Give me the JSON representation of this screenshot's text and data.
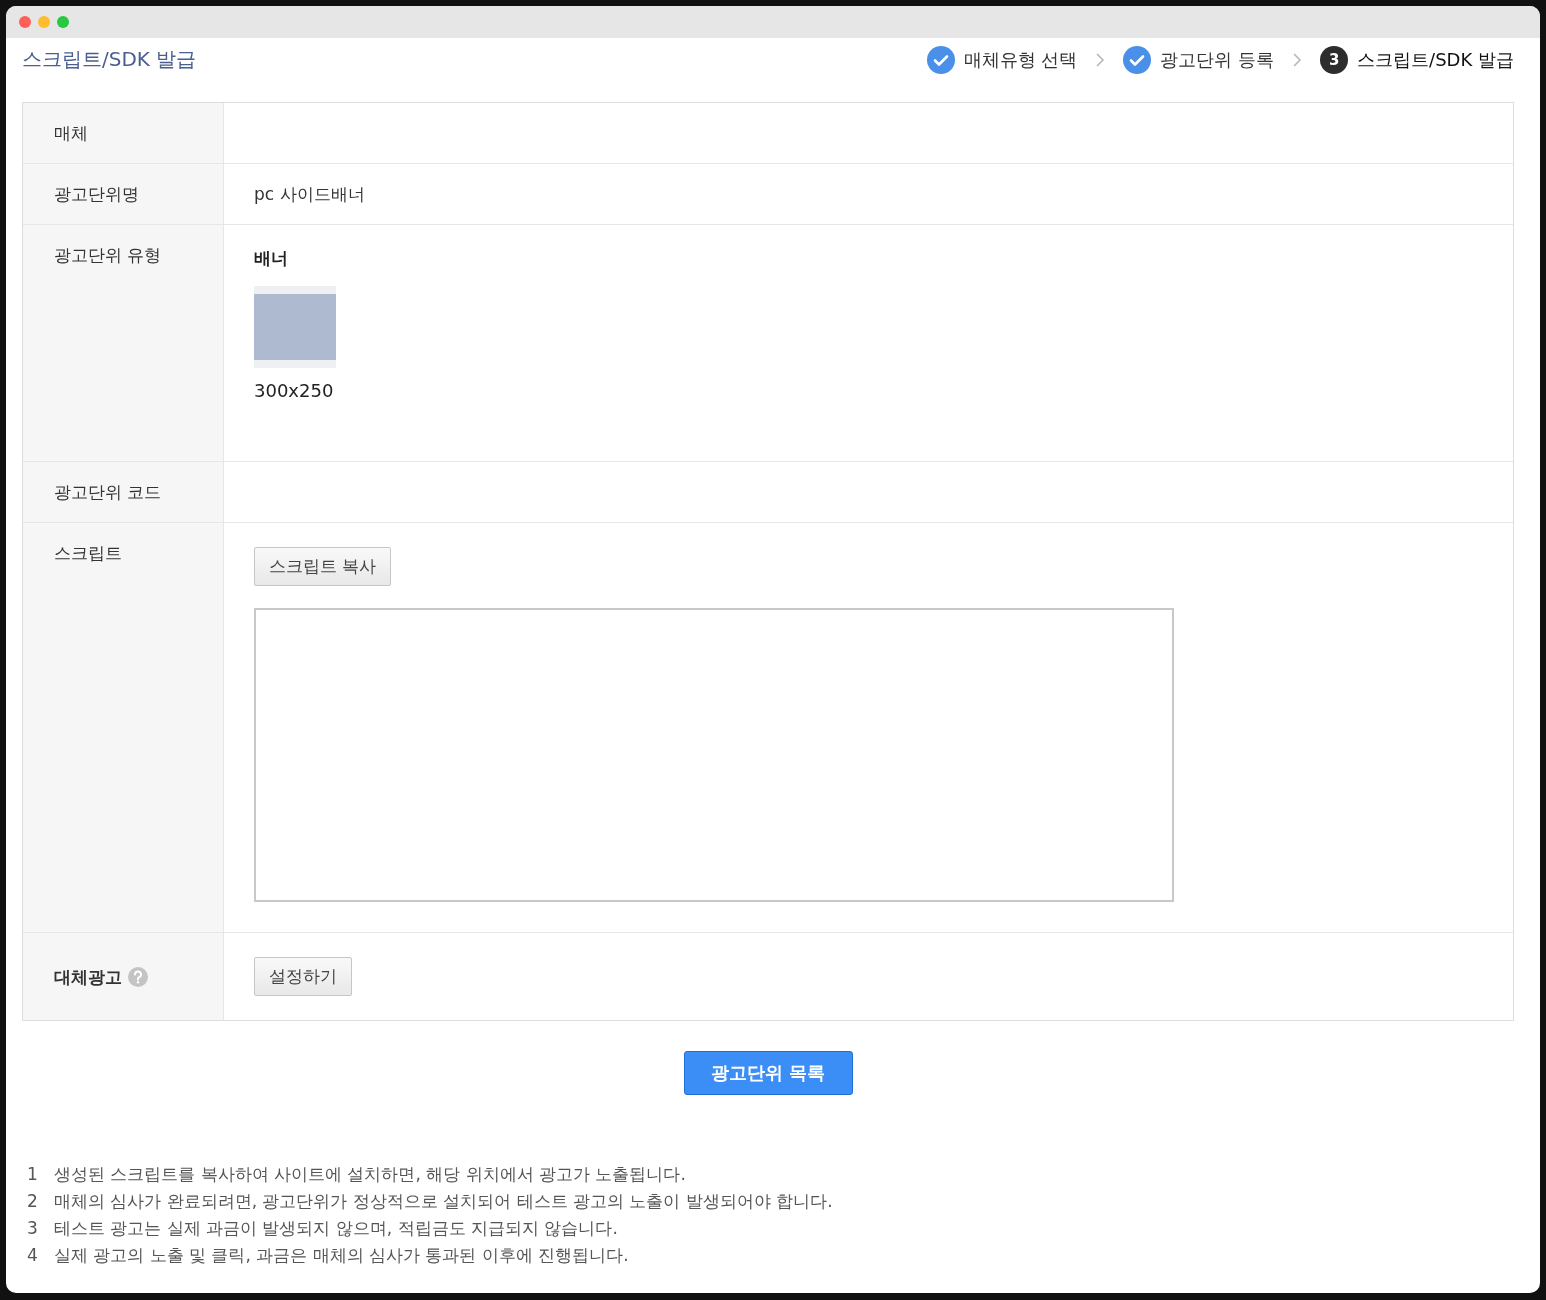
{
  "page_title": "스크립트/SDK 발급",
  "steps": [
    {
      "kind": "done",
      "label": "매체유형 선택"
    },
    {
      "kind": "current",
      "number": "3",
      "label": "스크립트/SDK 발급",
      "prefix": [
        "광고단위 등록"
      ]
    }
  ],
  "rows": [
    {
      "label": "매체",
      "bold": false,
      "help": false,
      "kind": "empty"
    },
    {
      "label": "광고단위명",
      "bold": false,
      "help": false,
      "kind": "text",
      "value": "pc 사이드배너"
    },
    {
      "label": "광고단위 유형",
      "bold": false,
      "help": false,
      "kind": "banner",
      "type_name": "배너",
      "size": "300x250"
    },
    {
      "label": "광고단위 코드",
      "bold": false,
      "help": false,
      "kind": "empty"
    },
    {
      "label": "스크립트",
      "bold": false,
      "help": false,
      "kind": "script",
      "button": "스크립트 복사"
    },
    {
      "label": "대체광고",
      "bold": true,
      "help": true,
      "kind": "button",
      "button": "설정하기"
    }
  ],
  "primary_button": "광고단위 목록",
  "notes": [
    {
      "number": "1",
      "text": "생성된 스크립트를 복사하여 사이트에 설치하면, 해당 위치에서 광고가 노출됩니다."
    },
    {
      "number": "2",
      "text": "매체의 심사가 완료되려면, 광고단위가 정상적으로 설치되어 테스트 광고의 노출이 발생되어야 합니다."
    },
    {
      "number": "3",
      "text": "테스트 광고는 실제 과금이 발생되지 않으며, 적립금도 지급되지 않습니다."
    },
    {
      "number": "4",
      "text": "실제 광고의 노출 및 클릭, 과금은 매체의 심사가 통과된 이후에 진행됩니다."
    }
  ]
}
